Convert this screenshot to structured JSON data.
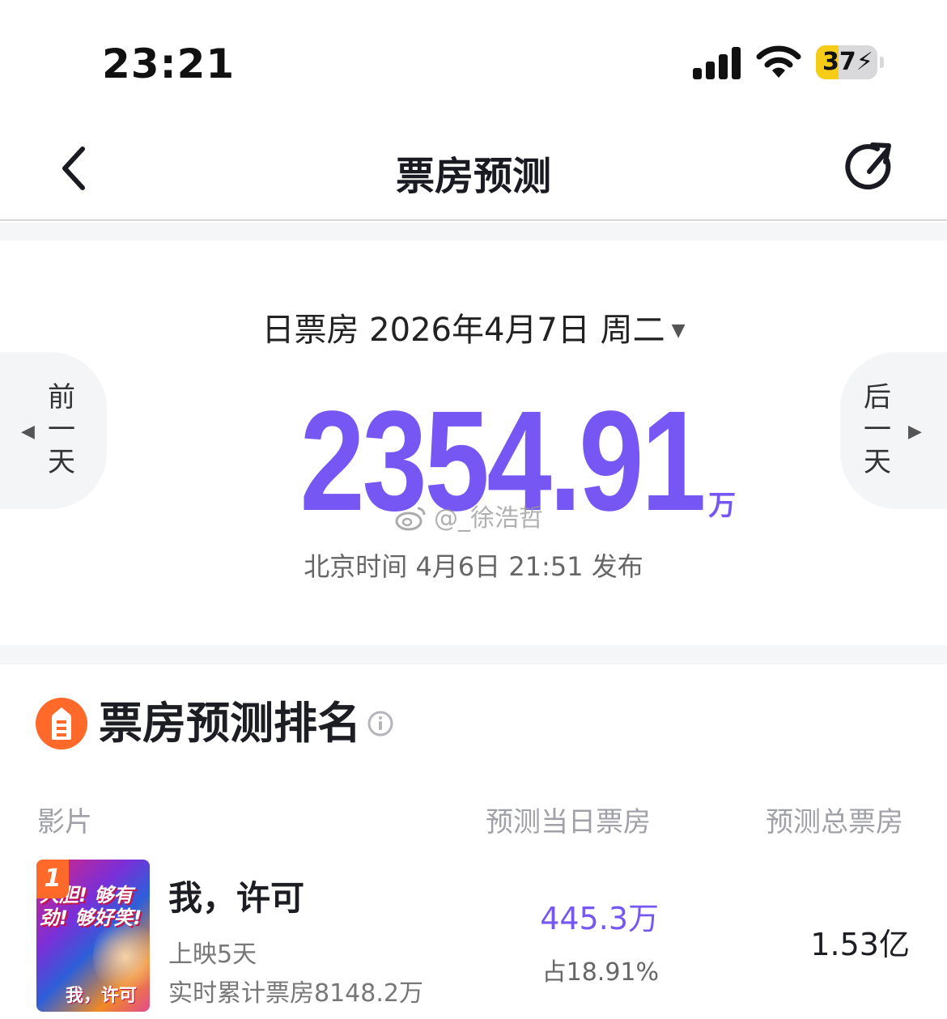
{
  "status_bar": {
    "time": "23:21",
    "battery_level": "37",
    "battery_fraction": 0.37,
    "icons": [
      "cellular-signal-icon",
      "wifi-icon",
      "battery-charging-icon"
    ]
  },
  "nav": {
    "title": "票房预测",
    "back_icon": "chevron-left-icon",
    "refresh_icon": "refresh-icon"
  },
  "summary": {
    "date_label": "日票房 2026年4月7日 周二",
    "caret": "▼",
    "prev_day_chars": [
      "前",
      "一",
      "天"
    ],
    "next_day_chars": [
      "后",
      "一",
      "天"
    ],
    "prev_arrow": "◀",
    "next_arrow": "▶",
    "box_office_value": "2354.91",
    "box_office_unit": "万",
    "publish_info": "北京时间 4月6日 21:51 发布",
    "watermark": "@_徐浩哲"
  },
  "ranking": {
    "title": "票房预测排名",
    "columns": {
      "film": "影片",
      "daily": "预测当日票房",
      "total": "预测总票房"
    },
    "movies": [
      {
        "rank": "1",
        "poster_text": "大胆! 够有劲! 够好笑!",
        "poster_title": "我，许可",
        "title": "我，许可",
        "days_showing": "上映5天",
        "cumulative": "实时累计票房8148.2万",
        "daily_forecast": "445.3万",
        "daily_share": "占18.91%",
        "total_forecast": "1.53亿"
      }
    ]
  },
  "colors": {
    "accent_purple": "#7657f3",
    "rank_orange": "#ff6a2a",
    "battery_yellow": "#f5cc18"
  }
}
